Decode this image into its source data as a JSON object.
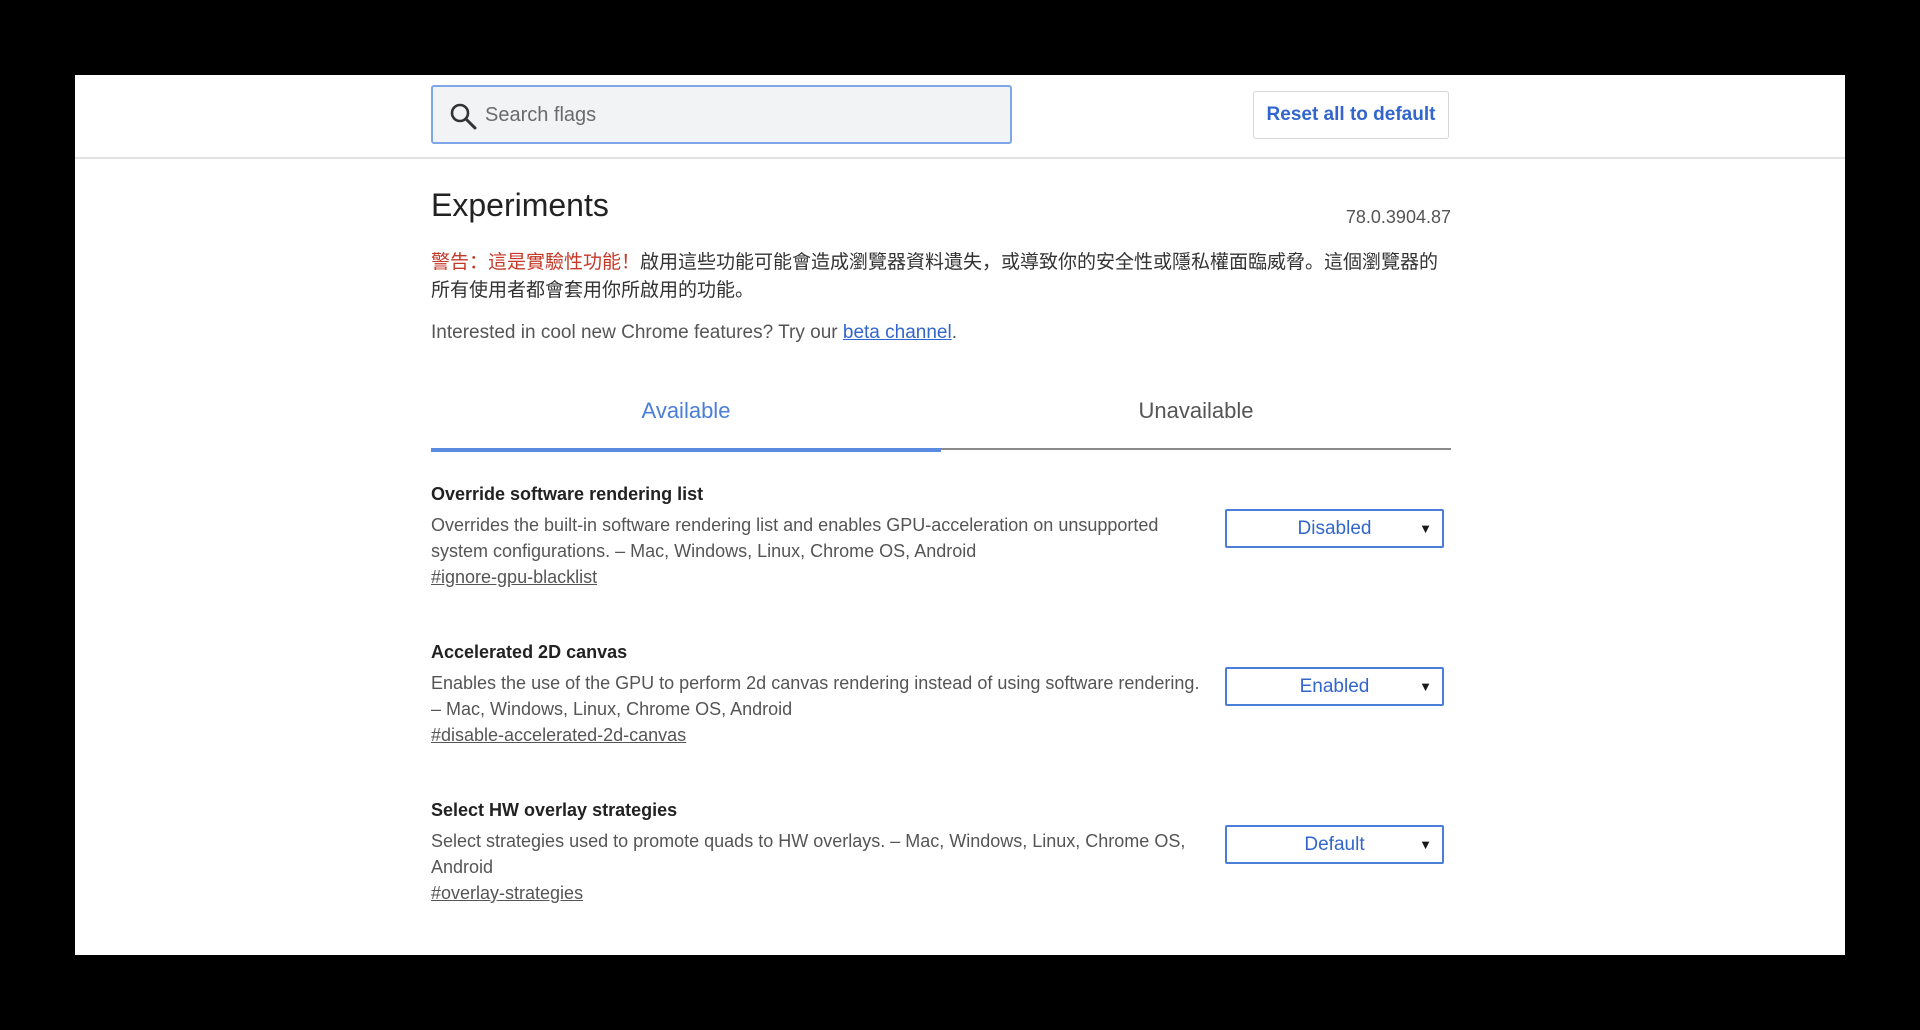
{
  "header": {
    "search_placeholder": "Search flags",
    "reset_label": "Reset all to default"
  },
  "page": {
    "title": "Experiments",
    "version": "78.0.3904.87",
    "warning_red": "警告：這是實驗性功能！",
    "warning_text": "啟用這些功能可能會造成瀏覽器資料遺失，或導致你的安全性或隱私權面臨威脅。這個瀏覽器的所有使用者都會套用你所啟用的功能。",
    "intro_text": "Interested in cool new Chrome features? Try our ",
    "intro_link": "beta channel",
    "intro_end": "."
  },
  "tabs": [
    {
      "label": "Available",
      "active": true
    },
    {
      "label": "Unavailable",
      "active": false
    }
  ],
  "experiments": [
    {
      "name": "Override software rendering list",
      "description": "Overrides the built-in software rendering list and enables GPU-acceleration on unsupported system configurations. – Mac, Windows, Linux, Chrome OS, Android",
      "link": "#ignore-gpu-blacklist",
      "value": "Disabled"
    },
    {
      "name": "Accelerated 2D canvas",
      "description": "Enables the use of the GPU to perform 2d canvas rendering instead of using software rendering. – Mac, Windows, Linux, Chrome OS, Android",
      "link": "#disable-accelerated-2d-canvas",
      "value": "Enabled"
    },
    {
      "name": "Select HW overlay strategies",
      "description": "Select strategies used to promote quads to HW overlays. – Mac, Windows, Linux, Chrome OS, Android",
      "link": "#overlay-strategies",
      "value": "Default"
    }
  ],
  "colors": {
    "accent": "#3266cc",
    "warning": "#c53929",
    "tab_active": "#4a7ed8"
  }
}
